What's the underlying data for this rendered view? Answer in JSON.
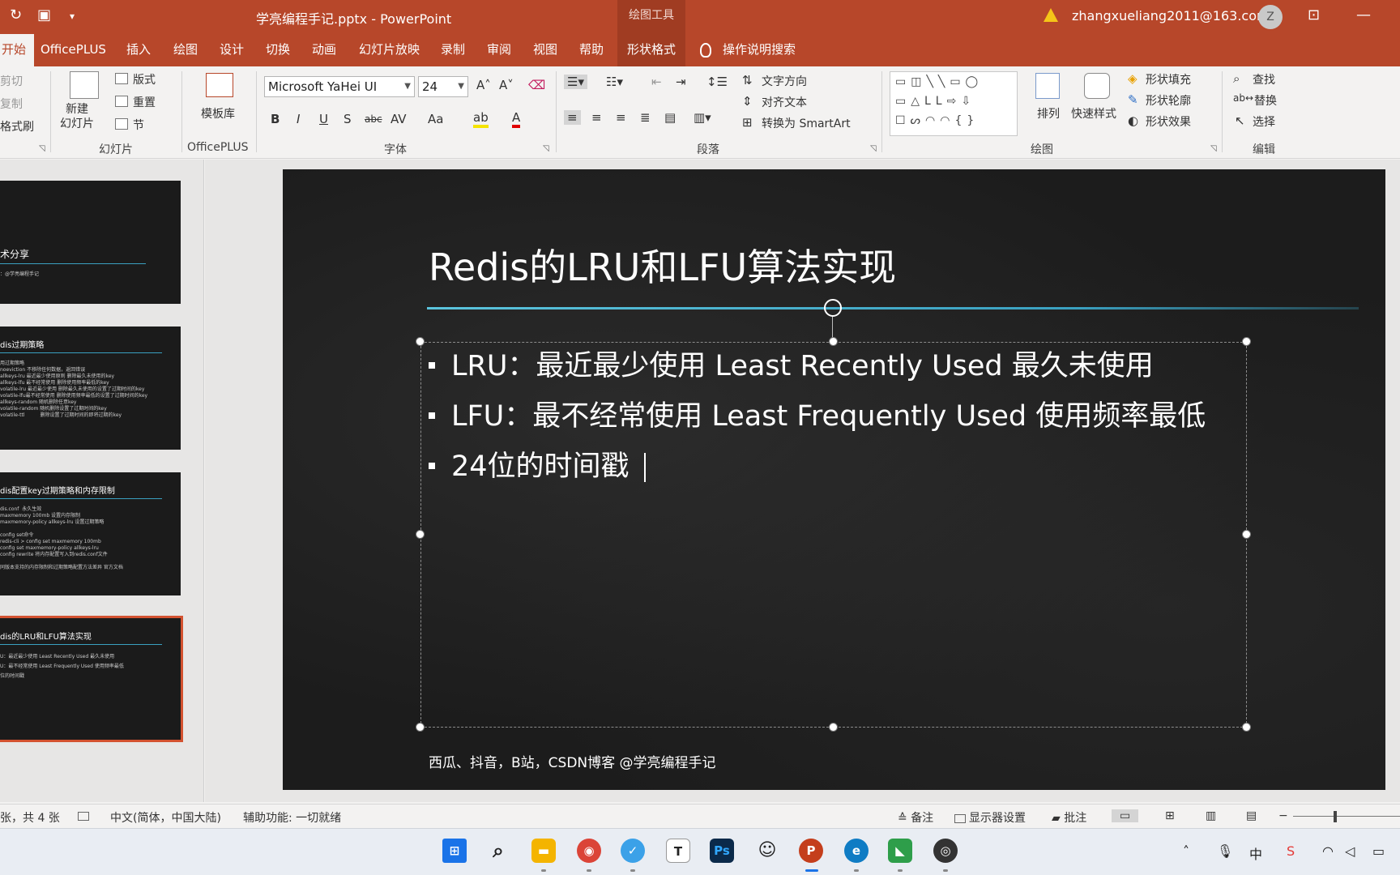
{
  "titlebar": {
    "title": "学亮编程手记.pptx  -  PowerPoint",
    "contextual_tab": "绘图工具",
    "user_email": "zhangxueliang2011@163.com",
    "avatar_initial": "Z"
  },
  "tabs": [
    "开始",
    "OfficePLUS",
    "插入",
    "绘图",
    "设计",
    "切换",
    "动画",
    "幻灯片放映",
    "录制",
    "审阅",
    "视图",
    "帮助",
    "形状格式"
  ],
  "tell_me": "操作说明搜索",
  "ribbon": {
    "clipboard": {
      "cut": "剪切",
      "copy": "复制",
      "format_painter": "格式刷"
    },
    "slides": {
      "new_slide": "新建\n幻灯片",
      "layout": "版式",
      "reset": "重置",
      "section": "节",
      "label": "幻灯片"
    },
    "officeplus": {
      "template": "模板库",
      "label": "OfficePLUS"
    },
    "font": {
      "family": "Microsoft YaHei UI",
      "size": "24",
      "label": "字体",
      "buttons": [
        "B",
        "I",
        "U",
        "S",
        "abc",
        "AV",
        "Aa",
        "A"
      ]
    },
    "paragraph": {
      "text_direction": "文字方向",
      "align_text": "对齐文本",
      "smartart": "转换为 SmartArt",
      "label": "段落"
    },
    "drawing": {
      "arrange": "排列",
      "quick_styles": "快速样式",
      "shape_fill": "形状填充",
      "shape_outline": "形状轮廓",
      "shape_effects": "形状效果",
      "label": "绘图"
    },
    "editing": {
      "find": "查找",
      "replace": "替换",
      "select": "选择",
      "label": "编辑"
    }
  },
  "thumbnails": [
    {
      "title": "术分享",
      "body": "：@学亮编程手记"
    },
    {
      "title": "dis过期策略",
      "body": "用过期策略\nnoeviction 不移除任何数据，返回错误\nallkeys-lru 最近最少使用原则 删除最久未使用的key\nallkeys-lfu 最不经常使用 删除使用频率最低的key\nvolatile-lru 最近最少使用 删除最久未使用的设置了过期时间的key\nvolatile-lfu最不经常使用 删除使用频率最低的设置了过期时间的key\nallkeys-random 随机删除任意key\nvolatile-random 随机删除设置了过期时间的key\nvolatile-ttl          删除设置了过期时间的即将过期的key"
    },
    {
      "title": "dis配置key过期策略和内存限制",
      "body": "dis.conf  永久生效\nmaxmemory 100mb 设置内存限制\nmaxmemory-policy allkeys-lru 设置过期策略\n\nconfig set命令\nredis-cli > config set maxmemory 100mb\nconfig set maxmemory-policy allkeys-lru\nconfig rewrite 将内存配置写入到redis.conf文件\n\n同版本支持的内存限制和过期策略配置方法差异 官方文档"
    },
    {
      "title": "dis的LRU和LFU算法实现",
      "body": "U：最近最少使用 Least Recently Used 最久未使用\nU：最不经常使用 Least Frequently Used 使用频率最低\n位的时间戳"
    }
  ],
  "slide": {
    "title": "Redis的LRU和LFU算法实现",
    "bullets": [
      "LRU：最近最少使用 Least Recently Used 最久未使用",
      "LFU：最不经常使用 Least Frequently Used 使用频率最低",
      "24位的时间戳"
    ],
    "footer": "西瓜、抖音，B站，CSDN博客  @学亮编程手记"
  },
  "statusbar": {
    "slide_count": "张，共 4 张",
    "language": "中文(简体，中国大陆)",
    "accessibility": "辅助功能: 一切就绪",
    "notes": "备注",
    "display_settings": "显示器设置",
    "comments": "批注"
  },
  "taskbar": {
    "apps": [
      "start-icon",
      "search-icon",
      "file-explorer-icon",
      "chrome-icon",
      "vscode-icon",
      "typora-icon",
      "photoshop-icon",
      "emoji-icon",
      "powerpoint-icon",
      "edge-icon",
      "app-icon",
      "obs-icon"
    ],
    "ime": "中"
  },
  "colors": {
    "accent": "#b7472a",
    "slide_bg": "#1c1c1c",
    "rule": "#3aa0c0",
    "selection": "#d35230"
  }
}
